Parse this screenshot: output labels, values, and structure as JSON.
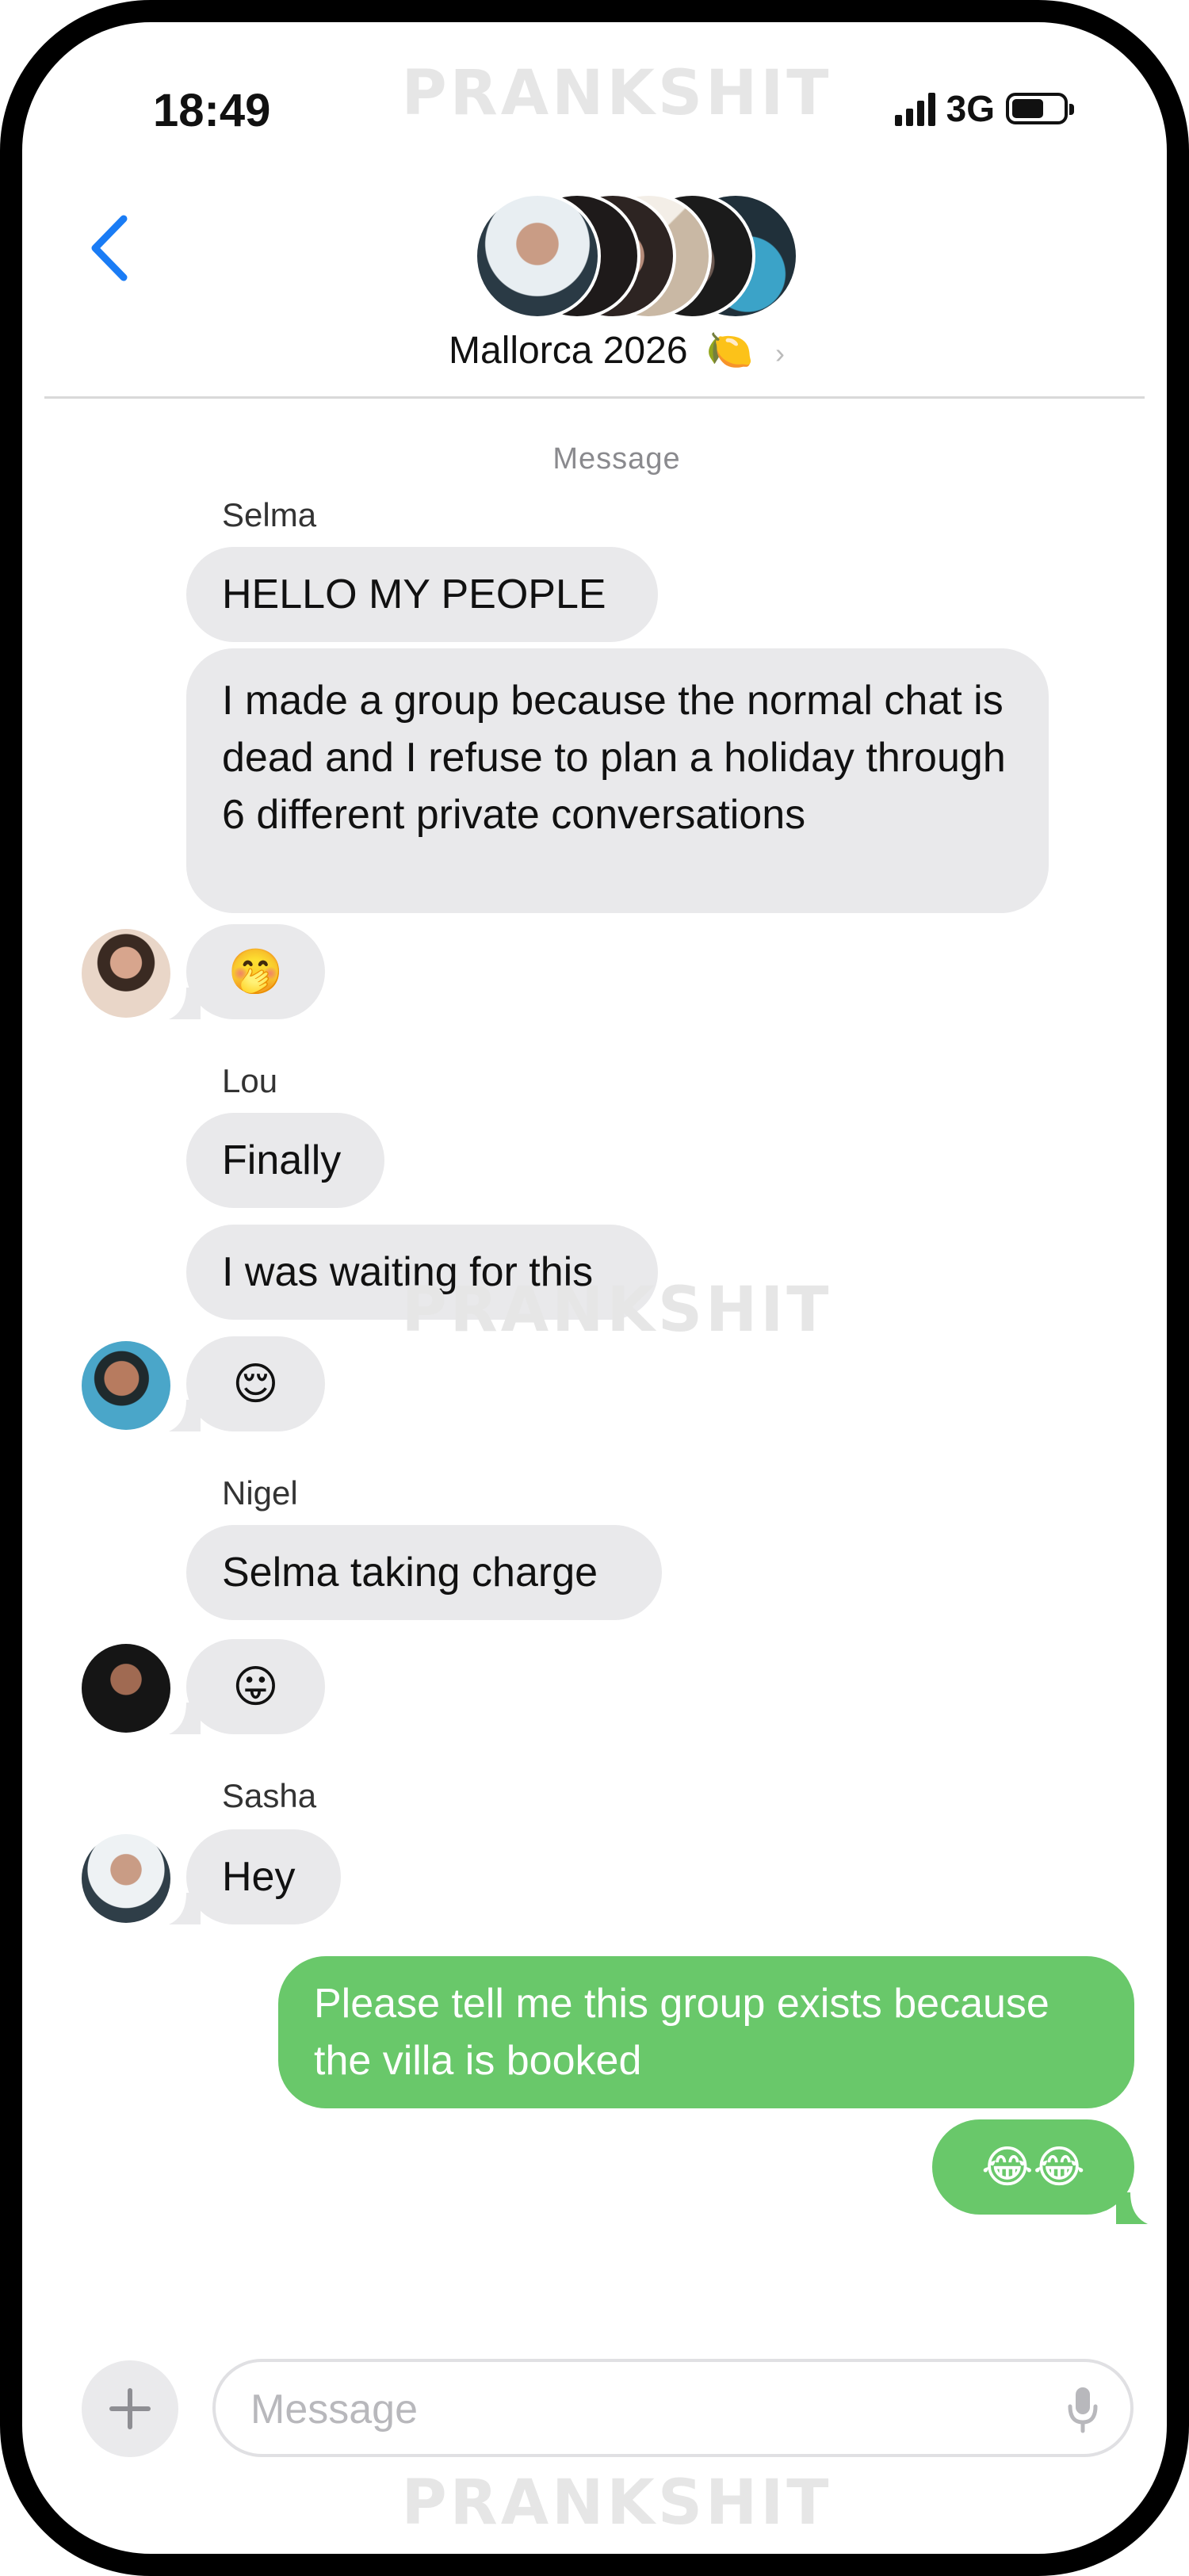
{
  "watermark": "PRANKSHIT",
  "status_bar": {
    "time": "18:49",
    "network": "3G",
    "battery_level": 0.55
  },
  "header": {
    "group_name": "Mallorca 2026",
    "group_emoji": "🍋",
    "chevron": "›",
    "back_icon": "chevron-left-icon"
  },
  "thread": {
    "meta_label": "Message",
    "groups": [
      {
        "sender": "Selma",
        "messages": [
          "HELLO MY PEOPLE",
          "I made a group because the normal chat is dead and I refuse to plan a holiday through 6 different private conversations",
          "🤭"
        ]
      },
      {
        "sender": "Lou",
        "messages": [
          "Finally",
          "I was waiting for this",
          "😌"
        ]
      },
      {
        "sender": "Nigel",
        "messages": [
          "Selma taking charge",
          "😛"
        ]
      },
      {
        "sender": "Sasha",
        "messages": [
          "Hey"
        ]
      }
    ],
    "outgoing": [
      "Please tell me this group exists because the villa is booked",
      "😂😂"
    ]
  },
  "composer": {
    "placeholder": "Message",
    "plus_icon": "plus-icon",
    "mic_icon": "microphone-icon"
  },
  "colors": {
    "accent": "#1a7cf5",
    "incoming_bubble": "#e9e9eb",
    "outgoing_bubble": "#69c86a"
  }
}
